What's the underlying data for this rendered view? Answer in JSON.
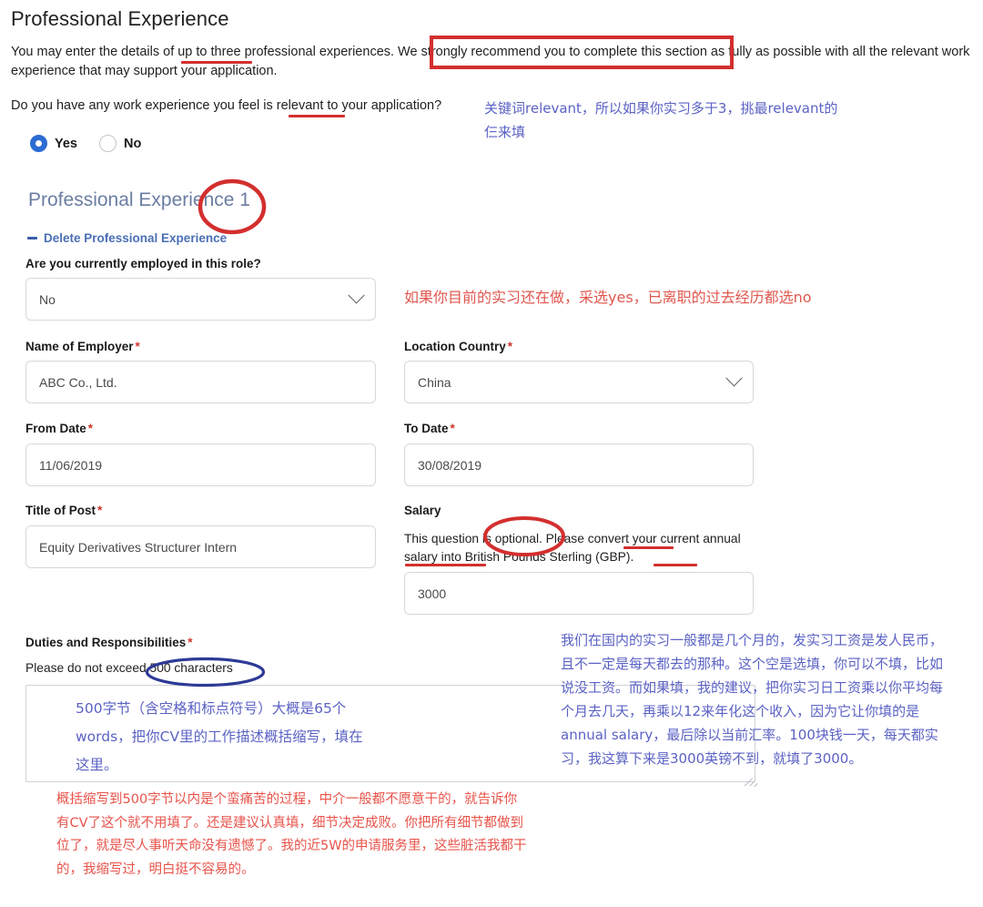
{
  "page": {
    "title": "Professional Experience",
    "intro": "You may enter the details of up to three professional experiences. We strongly recommend you to complete this section as fully as possible with all the relevant work experience that may support your application.",
    "work_question": "Do you have any work experience you feel is relevant to your application?"
  },
  "radio": {
    "yes_label": "Yes",
    "no_label": "No",
    "selected": "Yes"
  },
  "section": {
    "header": "Professional Experience 1",
    "delete_label": "Delete Professional Experience"
  },
  "fields": {
    "employed": {
      "label": "Are you currently employed in this role?",
      "value": "No"
    },
    "employer": {
      "label": "Name of Employer",
      "required": "*",
      "value": "ABC Co., Ltd."
    },
    "country": {
      "label": "Location Country",
      "required": "*",
      "value": "China"
    },
    "from_date": {
      "label": "From Date",
      "required": "*",
      "value": "11/06/2019"
    },
    "to_date": {
      "label": "To Date",
      "required": "*",
      "value": "30/08/2019"
    },
    "title_of_post": {
      "label": "Title of Post",
      "required": "*",
      "value": "Equity Derivatives Structurer Intern"
    },
    "salary": {
      "label": "Salary",
      "help": "This question is optional. Please convert your current annual salary into British Pounds Sterling (GBP).",
      "value": "3000"
    },
    "duties": {
      "label": "Duties and Responsibilities",
      "required": "*",
      "hint": "Please do not exceed 500 characters",
      "value": "500字节（含空格和标点符号）大概是65个words，把你CV里的工作描述概括缩写，填在这里。"
    }
  },
  "annotations": {
    "relevant_note": "关键词relevant，所以如果你实习多于3，挑最relevant的仨来填",
    "employed_note": "如果你目前的实习还在做，采选yes，已离职的过去经历都选no",
    "salary_note": "我们在国内的实习一般都是几个月的，发实习工资是发人民币，且不一定是每天都去的那种。这个空是选填，你可以不填，比如说没工资。而如果填，我的建议，把你实习日工资乘以你平均每个月去几天，再乘以12来年化这个收入，因为它让你填的是annual salary，最后除以当前汇率。100块钱一天，每天都实习，我这算下来是3000英镑不到，就填了3000。",
    "bottom_note": "概括缩写到500字节以内是个蛮痛苦的过程，中介一般都不愿意干的，就告诉你有CV了这个就不用填了。还是建议认真填，细节决定成败。你把所有细节都做到位了，就是尽人事听天命没有遗憾了。我的近5W的申请服务里，这些脏活我都干的，我缩写过，明白挺不容易的。"
  },
  "colors": {
    "annotation_red": "#d32f2f",
    "annotation_blue_text": "#5b62c4",
    "annotation_red_text": "#e8534a",
    "ellipse_navy": "#2d3a96",
    "radio_accent": "#2b6cd4",
    "section_header": "#6b7da3",
    "link_blue": "#4a6fb5",
    "required_star": "#d0342c"
  }
}
